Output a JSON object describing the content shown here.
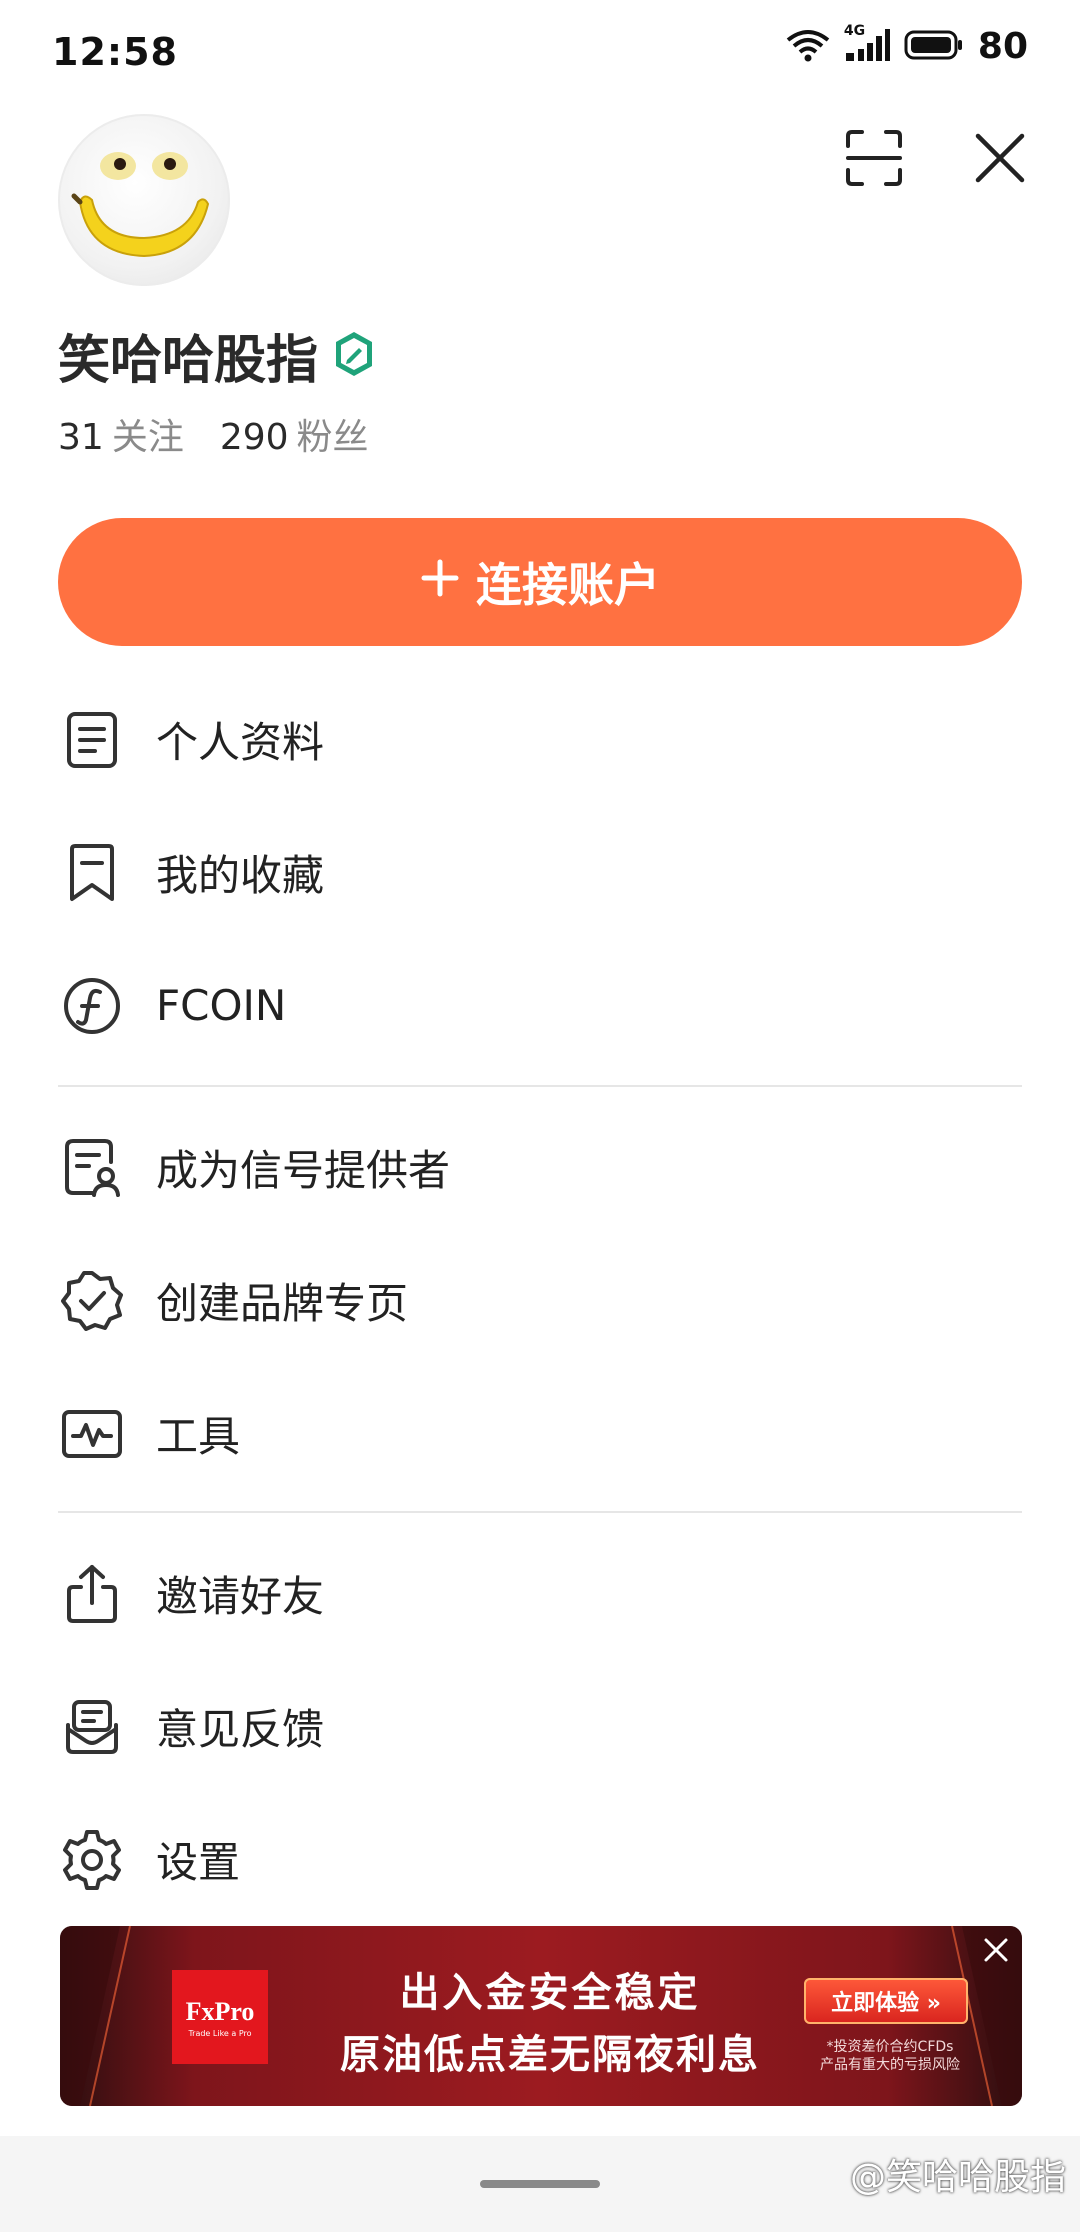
{
  "status_bar": {
    "time": "12:58",
    "network": "4G",
    "battery": "80"
  },
  "profile": {
    "name": "笑哈哈股指",
    "following_count": "31",
    "following_label": "关注",
    "followers_count": "290",
    "followers_label": "粉丝"
  },
  "connect_button": {
    "label": "连接账户"
  },
  "menu": {
    "group1": [
      {
        "label": "个人资料",
        "icon": "document-icon"
      },
      {
        "label": "我的收藏",
        "icon": "bookmark-icon"
      },
      {
        "label": "FCOIN",
        "icon": "fcoin-icon"
      }
    ],
    "group2": [
      {
        "label": "成为信号提供者",
        "icon": "signal-provider-icon"
      },
      {
        "label": "创建品牌专页",
        "icon": "verified-badge-icon"
      },
      {
        "label": "工具",
        "icon": "tools-icon"
      }
    ],
    "group3": [
      {
        "label": "邀请好友",
        "icon": "share-icon"
      },
      {
        "label": "意见反馈",
        "icon": "feedback-icon"
      },
      {
        "label": "设置",
        "icon": "gear-icon"
      }
    ]
  },
  "ad": {
    "brand": "FxPro",
    "brand_tagline": "Trade Like a Pro",
    "line1": "出入金安全稳定",
    "line2": "原油低点差无隔夜利息",
    "cta": "立即体验 »",
    "note_line1": "*投资差价合约CFDs",
    "note_line2": "产品有重大的亏损风险"
  },
  "watermark": "@笑哈哈股指",
  "colors": {
    "accent": "#ff7141",
    "verified_badge": "#1fa37a"
  }
}
